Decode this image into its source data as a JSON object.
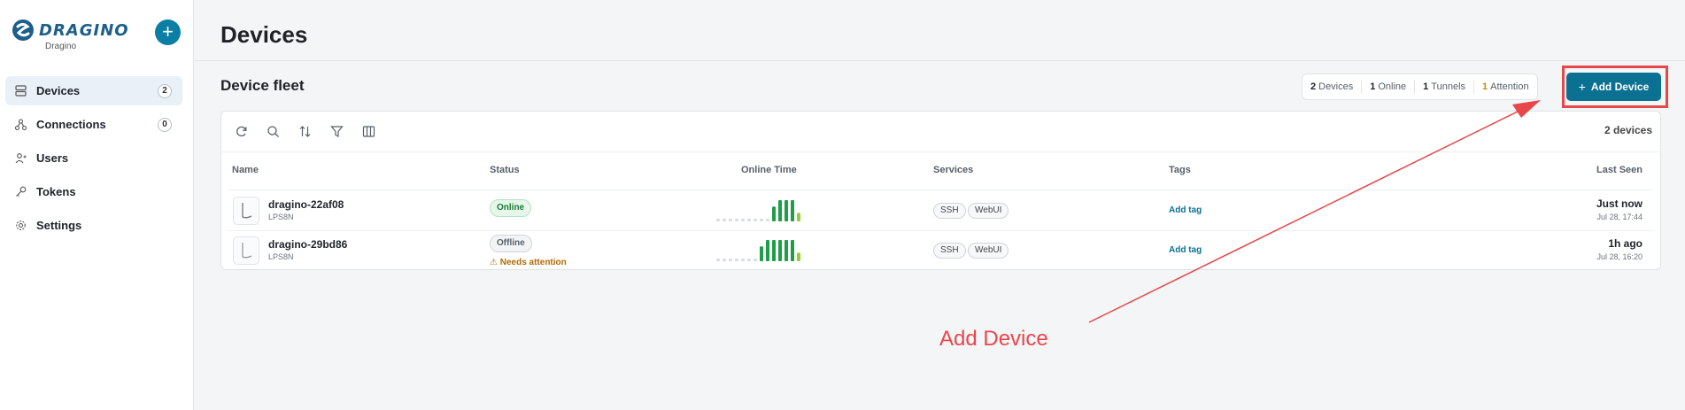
{
  "sidebar": {
    "logo_text": "DRAGINO",
    "org_name": "Dragino",
    "add_label": "+",
    "items": [
      {
        "label": "Devices",
        "badge": "2",
        "icon": "server-icon"
      },
      {
        "label": "Connections",
        "badge": "0",
        "icon": "network-icon"
      },
      {
        "label": "Users",
        "icon": "users-icon"
      },
      {
        "label": "Tokens",
        "icon": "key-icon"
      },
      {
        "label": "Settings",
        "icon": "gear-icon"
      }
    ]
  },
  "header": {
    "title": "Devices",
    "section_title": "Device fleet"
  },
  "stats": {
    "devices_count": "2",
    "devices_label": "Devices",
    "online_count": "1",
    "online_label": "Online",
    "tunnels_count": "1",
    "tunnels_label": "Tunnels",
    "attention_count": "1",
    "attention_label": "Attention"
  },
  "add_device_button": {
    "label": "Add Device"
  },
  "table": {
    "count_label": "2 devices",
    "columns": [
      "Name",
      "Status",
      "Online Time",
      "Services",
      "Tags",
      "Last Seen"
    ],
    "rows": [
      {
        "name": "dragino-22af08",
        "model": "LPS8N",
        "status": "Online",
        "attention": "",
        "services": [
          "SSH",
          "WebUI"
        ],
        "tag_action": "Add tag",
        "last_seen": "Just now",
        "last_seen_date": "Jul 28, 17:44",
        "uptime": [
          0,
          0,
          0,
          0,
          0,
          0,
          0,
          0,
          0,
          0.7,
          1,
          1,
          1,
          0.4
        ]
      },
      {
        "name": "dragino-29bd86",
        "model": "LPS8N",
        "status": "Offline",
        "attention": "Needs attention",
        "services": [
          "SSH",
          "WebUI"
        ],
        "tag_action": "Add tag",
        "last_seen": "1h ago",
        "last_seen_date": "Jul 28, 16:20",
        "uptime": [
          0,
          0,
          0,
          0,
          0,
          0,
          0,
          0.7,
          1,
          1,
          1,
          1,
          1,
          0.4
        ]
      }
    ]
  },
  "annotation": {
    "text": "Add Device"
  },
  "colors": {
    "accent": "#0a7192",
    "online": "#1e9e48",
    "annotation": "#e8474a",
    "attention": "#c58a00"
  }
}
